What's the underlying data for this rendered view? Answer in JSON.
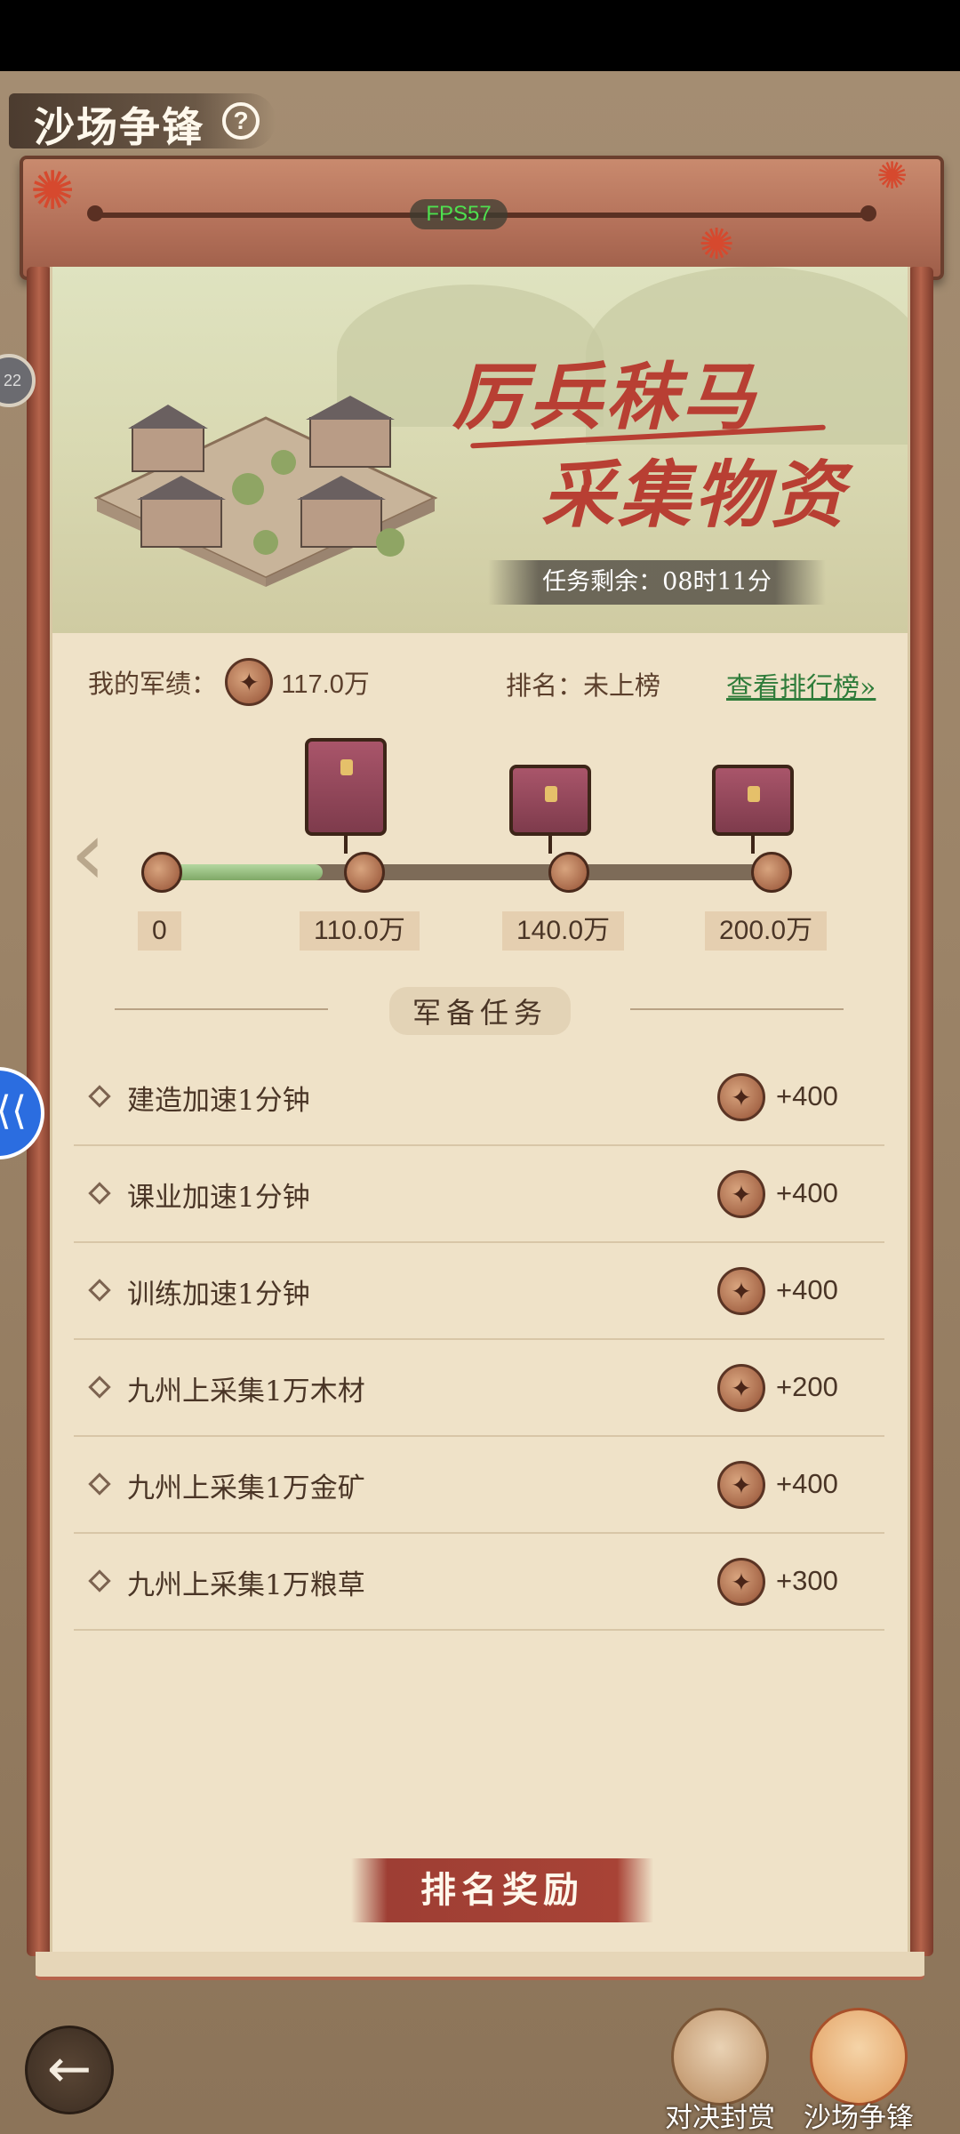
{
  "header": {
    "title": "沙场争锋",
    "help_symbol": "?"
  },
  "fps": "FPS57",
  "banner": {
    "title_line1": "厉兵秣马",
    "title_line2": "采集物资",
    "remain_label": "任务剩余：",
    "remain_time": "08时11分"
  },
  "score": {
    "label": "我的军绩：",
    "value": "117.0万",
    "rank_label": "排名：未上榜",
    "rank_link": "查看排行榜»"
  },
  "progress": {
    "current_fraction": 0.27,
    "milestones": [
      {
        "label": "0"
      },
      {
        "label": "110.0万"
      },
      {
        "label": "140.0万"
      },
      {
        "label": "200.0万"
      }
    ]
  },
  "tasks": {
    "section_title": "军备任务",
    "items": [
      {
        "name": "建造加速1分钟",
        "points": "+400"
      },
      {
        "name": "课业加速1分钟",
        "points": "+400"
      },
      {
        "name": "训练加速1分钟",
        "points": "+400"
      },
      {
        "name": "九州上采集1万木材",
        "points": "+200"
      },
      {
        "name": "九州上采集1万金矿",
        "points": "+400"
      },
      {
        "name": "九州上采集1万粮草",
        "points": "+300"
      }
    ]
  },
  "rank_reward_button": "排名奖励",
  "side_badge": "22",
  "side_fab_icon": "⟨⟨",
  "bottom_nav": {
    "back_icon": "back-arrow-icon",
    "tabs": [
      {
        "label": "对决封赏"
      },
      {
        "label": "沙场争锋"
      }
    ]
  },
  "colors": {
    "accent_red": "#b83f33",
    "link_green": "#2f7c3a",
    "fps_green": "#4fe04f"
  }
}
